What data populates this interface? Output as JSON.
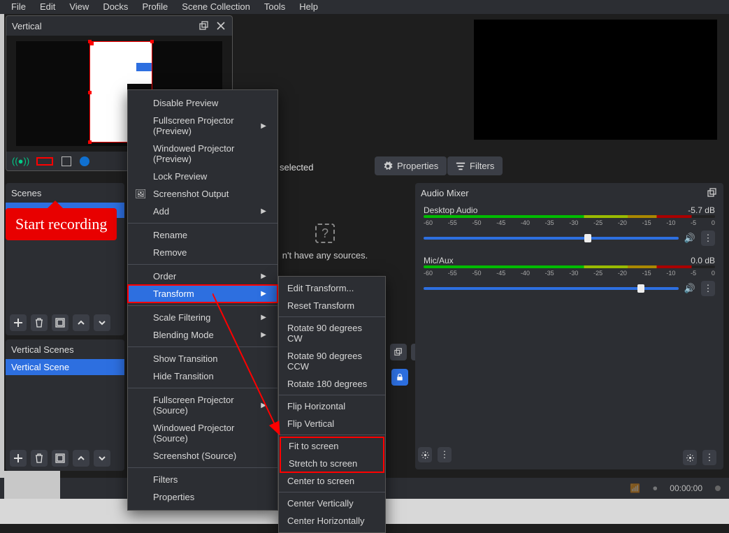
{
  "menubar": [
    "File",
    "Edit",
    "View",
    "Docks",
    "Profile",
    "Scene Collection",
    "Tools",
    "Help"
  ],
  "vertical_panel": {
    "title": "Vertical"
  },
  "callout_text": "Start recording",
  "no_source_selected": "selected",
  "properties_btn": "Properties",
  "filters_btn": "Filters",
  "sources_empty_line1": "n't have any sources.",
  "scenes": {
    "title": "Scenes"
  },
  "vertical_scenes": {
    "title": "Vertical Scenes",
    "row": "Vertical Scene"
  },
  "audio": {
    "title": "Audio Mixer",
    "ch1": {
      "name": "Desktop Audio",
      "level": "-5.7 dB"
    },
    "ch2": {
      "name": "Mic/Aux",
      "level": "0.0 dB"
    },
    "scale": [
      "-60",
      "-55",
      "-50",
      "-45",
      "-40",
      "-35",
      "-30",
      "-25",
      "-20",
      "-15",
      "-10",
      "-5",
      "0"
    ]
  },
  "status": {
    "time": "00:00:00"
  },
  "ctx_menu": {
    "disable_preview": "Disable Preview",
    "fullscreen_preview": "Fullscreen Projector (Preview)",
    "windowed_preview": "Windowed Projector (Preview)",
    "lock_preview": "Lock Preview",
    "screenshot_output": "Screenshot Output",
    "add": "Add",
    "rename": "Rename",
    "remove": "Remove",
    "order": "Order",
    "transform": "Transform",
    "scale_filtering": "Scale Filtering",
    "blending_mode": "Blending Mode",
    "show_transition": "Show Transition",
    "hide_transition": "Hide Transition",
    "fullscreen_source": "Fullscreen Projector (Source)",
    "windowed_source": "Windowed Projector (Source)",
    "screenshot_source": "Screenshot (Source)",
    "filters": "Filters",
    "properties": "Properties"
  },
  "sub_menu": {
    "edit_transform": "Edit Transform...",
    "reset_transform": "Reset Transform",
    "rotate_90_cw": "Rotate 90 degrees CW",
    "rotate_90_ccw": "Rotate 90 degrees CCW",
    "rotate_180": "Rotate 180 degrees",
    "flip_horizontal": "Flip Horizontal",
    "flip_vertical": "Flip Vertical",
    "fit_to_screen": "Fit to screen",
    "stretch_to_screen": "Stretch to screen",
    "center_to_screen": "Center to screen",
    "center_vertically": "Center Vertically",
    "center_horizontally": "Center Horizontally"
  }
}
